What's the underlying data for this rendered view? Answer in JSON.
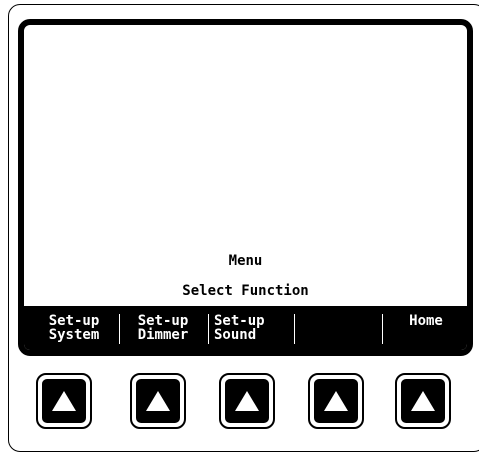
{
  "display": {
    "title": "Menu",
    "subtitle": "Select Function"
  },
  "softkeys": [
    {
      "line1": "Set-up",
      "line2": "System"
    },
    {
      "line1": "Set-up",
      "line2": "Dimmer"
    },
    {
      "line1": "Set-up",
      "line2": "Sound"
    },
    {
      "line1": "",
      "line2": ""
    },
    {
      "line1": "Home",
      "line2": ""
    }
  ],
  "hardware_buttons": [
    {
      "icon": "triangle-up-icon"
    },
    {
      "icon": "triangle-up-icon"
    },
    {
      "icon": "triangle-up-icon"
    },
    {
      "icon": "triangle-up-icon"
    },
    {
      "icon": "triangle-up-icon"
    }
  ],
  "colors": {
    "bezel": "#000000",
    "background": "#ffffff",
    "softkey_text": "#ffffff"
  }
}
